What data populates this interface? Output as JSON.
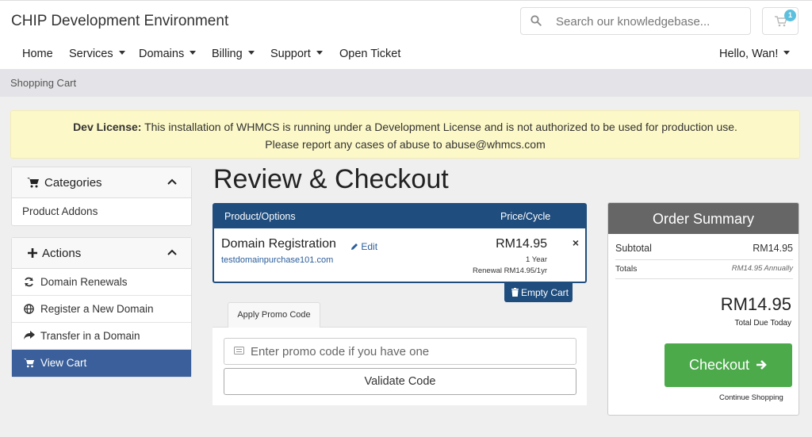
{
  "header": {
    "site_title": "CHIP Development Environment",
    "search_placeholder": "Search our knowledgebase...",
    "cart_count": "1"
  },
  "nav": {
    "items": [
      "Home",
      "Services",
      "Domains",
      "Billing",
      "Support",
      "Open Ticket"
    ],
    "user_menu": "Hello, Wan!"
  },
  "breadcrumb": "Shopping Cart",
  "alert": {
    "bold": "Dev License:",
    "line1": "This installation of WHMCS is running under a Development License and is not authorized to be used for production use.",
    "line2": "Please report any cases of abuse to abuse@whmcs.com"
  },
  "sidebar": {
    "categories": {
      "title": "Categories",
      "items": [
        "Product Addons"
      ]
    },
    "actions": {
      "title": "Actions",
      "items": [
        "Domain Renewals",
        "Register a New Domain",
        "Transfer in a Domain",
        "View Cart"
      ]
    }
  },
  "main": {
    "title": "Review & Checkout",
    "table": {
      "col_product": "Product/Options",
      "col_price": "Price/Cycle",
      "item_name": "Domain Registration",
      "edit_label": "Edit",
      "domain": "testdomainpurchase101.com",
      "price": "RM14.95",
      "cycle": "1 Year",
      "renewal": "Renewal RM14.95/1yr",
      "remove": "×"
    },
    "empty_cart": "Empty Cart",
    "promo": {
      "tab": "Apply Promo Code",
      "placeholder": "Enter promo code if you have one",
      "validate": "Validate Code"
    }
  },
  "summary": {
    "title": "Order Summary",
    "subtotal_label": "Subtotal",
    "subtotal_value": "RM14.95",
    "totals_label": "Totals",
    "totals_value": "RM14.95 Annually",
    "total_due": "RM14.95",
    "total_due_label": "Total Due Today",
    "checkout": "Checkout",
    "continue": "Continue Shopping"
  },
  "colors": {
    "primary": "#1f4d7e",
    "sidebar_active": "#3a5f9a",
    "checkout_green": "#4caa4b",
    "alert_bg": "#fcf8c7"
  }
}
